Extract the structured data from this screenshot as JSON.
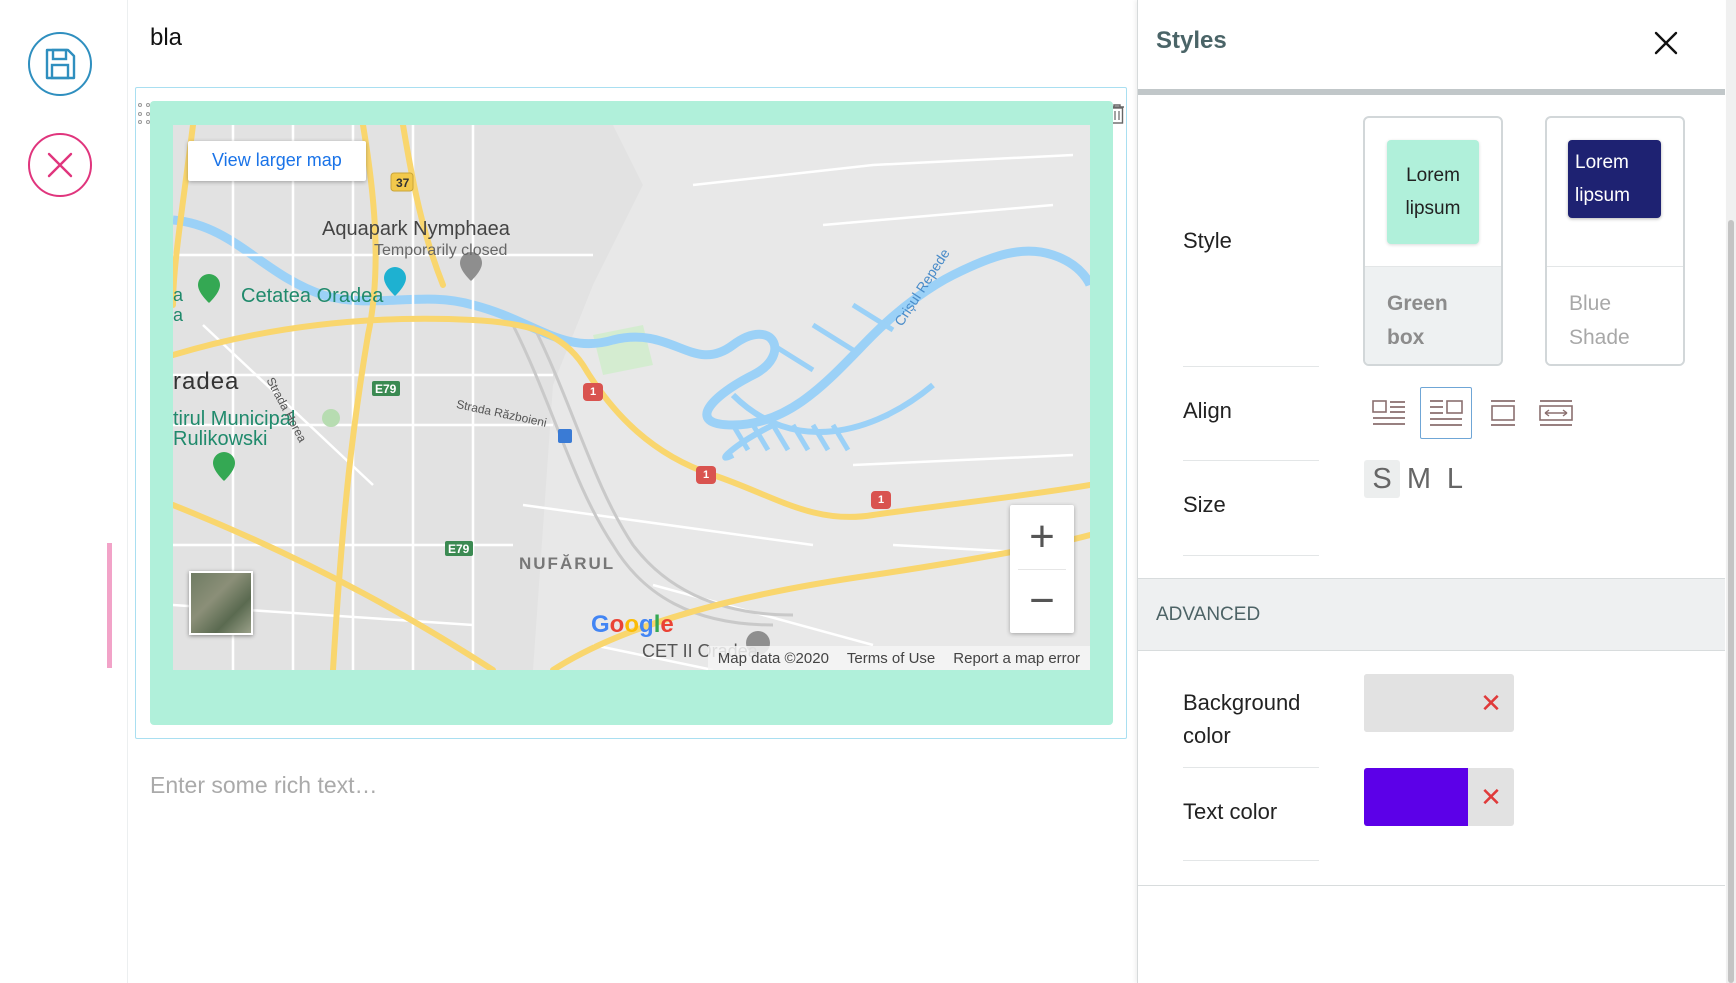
{
  "editor": {
    "title": "bla",
    "rich_text_placeholder": "Enter some rich text…",
    "map": {
      "view_larger_map": "View larger map",
      "zoom_in": "+",
      "zoom_out": "−",
      "logo": "Google",
      "attribution": {
        "map_data": "Map data ©2020",
        "terms": "Terms of Use",
        "report": "Report a map error"
      },
      "labels": {
        "aquapark": "Aquapark Nymphaea",
        "temporarily_closed": "Temporarily closed",
        "cetatea": "Cetatea Oradea",
        "oradea": "radea",
        "centrul": "tirul Municipal",
        "rulikowski": "Rulikowski",
        "strada_horea": "Strada Horea",
        "strada_razboieni": "Strada Războieni",
        "crisul": "Crișul Repede",
        "nufarul": "NUFĂRUL",
        "cet": "CET II Oradea",
        "left_a1": "a",
        "left_a2": "a",
        "e79_1": "E79",
        "e79_2": "E79",
        "r37": "37",
        "r1a": "1",
        "r1b": "1",
        "r1c": "1"
      }
    }
  },
  "panel": {
    "title": "Styles",
    "style_label": "Style",
    "align_label": "Align",
    "size_label": "Size",
    "styles": [
      {
        "sample": "Lorem lipsum",
        "name": "Green box"
      },
      {
        "sample": "Lorem lipsum",
        "name": "Blue Shade"
      }
    ],
    "sizes": [
      "S",
      "M",
      "L"
    ],
    "selected_size": "S",
    "advanced_label": "ADVANCED",
    "background_color_label": "Background color",
    "text_color_label": "Text color",
    "text_color_value": "#5c00e8",
    "clear_symbol": "✕"
  }
}
